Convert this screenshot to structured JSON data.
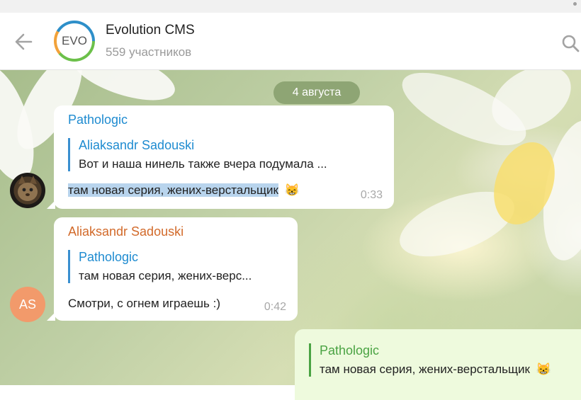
{
  "header": {
    "avatar_text": "EVO",
    "title": "Evolution CMS",
    "subtitle": "559 участников",
    "icons": {
      "back": "back-arrow-icon",
      "search": "search-icon"
    }
  },
  "date_separator": "4 августа",
  "messages": [
    {
      "sender": "Pathologic",
      "sender_color": "#1e8bd0",
      "reply_name": "Aliaksandr Sadouski",
      "reply_text": "Вот и наша нинель также вчера подумала ...",
      "text": "там новая серия, жених-верстальщик",
      "emoji": "😸",
      "time": "0:33",
      "avatar": "cat-photo"
    },
    {
      "sender": "Aliaksandr Sadouski",
      "sender_color": "#d26a2a",
      "reply_name": "Pathologic",
      "reply_text": "там новая серия, жених-верс...",
      "text": "Смотри, с огнем играешь :)",
      "time": "0:42",
      "avatar_initials": "AS"
    }
  ],
  "outgoing": {
    "reply_name": "Pathologic",
    "reply_text": "там новая серия, жених-верстальщик",
    "emoji": "😸"
  },
  "colors": {
    "accent": "#1e8bd0",
    "outgoing_reply": "#4aa343",
    "date_pill": "#8ea574",
    "highlight": "#b8d4ed"
  }
}
